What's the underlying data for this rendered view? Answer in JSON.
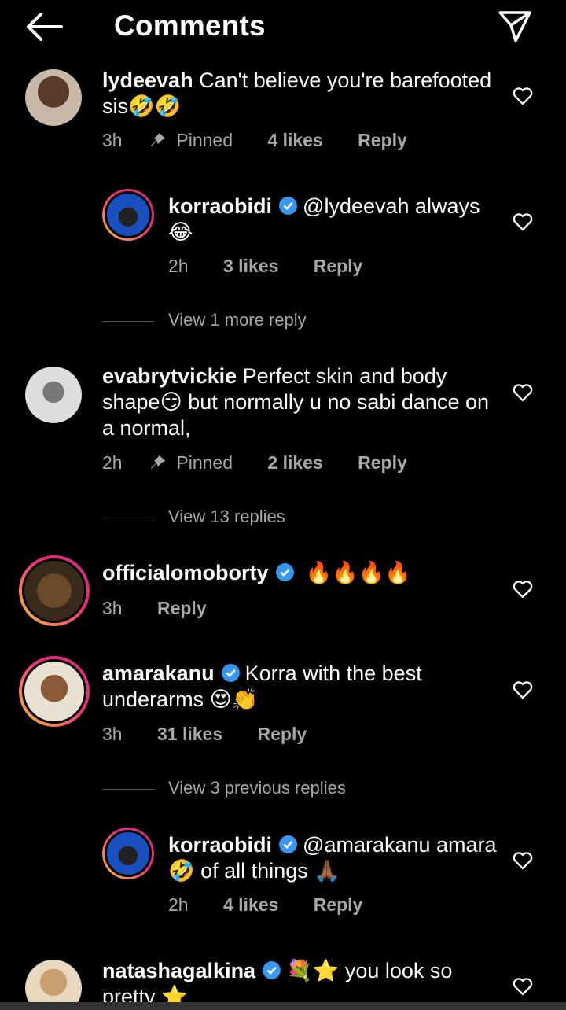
{
  "header": {
    "title": "Comments",
    "back_icon": "arrow-left-icon",
    "send_icon": "paper-plane-icon"
  },
  "comments": [
    {
      "username": "lydeevah",
      "text": "Can't believe you're barefooted sis",
      "emojis": "🤣🤣",
      "time": "3h",
      "pinned": "Pinned",
      "likes": "4 likes",
      "reply": "Reply"
    },
    {
      "username": "korraobidi",
      "text": "@lydeevah always",
      "emojis": "😂",
      "time": "2h",
      "likes": "3 likes",
      "reply": "Reply"
    },
    {
      "view_more": "View 1 more reply"
    },
    {
      "username": "evabrytvickie",
      "text_part1": "Perfect skin and body shape",
      "emoji": "😏",
      "text_part2": "but normally u no sabi dance on a normal,",
      "time": "2h",
      "pinned": "Pinned",
      "likes": "2 likes",
      "reply": "Reply"
    },
    {
      "view_more": "View 13 replies"
    },
    {
      "username": "officialomoborty",
      "emojis": "🔥🔥🔥🔥",
      "time": "3h",
      "reply": "Reply"
    },
    {
      "username": "amarakanu",
      "text": "Korra with the best underarms",
      "emojis": "😍👏",
      "time": "3h",
      "likes": "31 likes",
      "reply": "Reply"
    },
    {
      "view_more": "View 3 previous replies"
    },
    {
      "username": "korraobidi",
      "text_part1": "@amarakanu amara",
      "emoji": "🤣",
      "text_part2": "of all things",
      "emoji2": "🙏🏾",
      "time": "2h",
      "likes": "4 likes",
      "reply": "Reply"
    },
    {
      "username": "natashagalkina",
      "text": "you look so pretty",
      "emojis_before": "💐⭐",
      "emojis_after": "⭐"
    }
  ],
  "colors": {
    "background": "#000000",
    "text": "#ffffff",
    "meta": "#a8a8a8",
    "verified": "#3897f0"
  }
}
